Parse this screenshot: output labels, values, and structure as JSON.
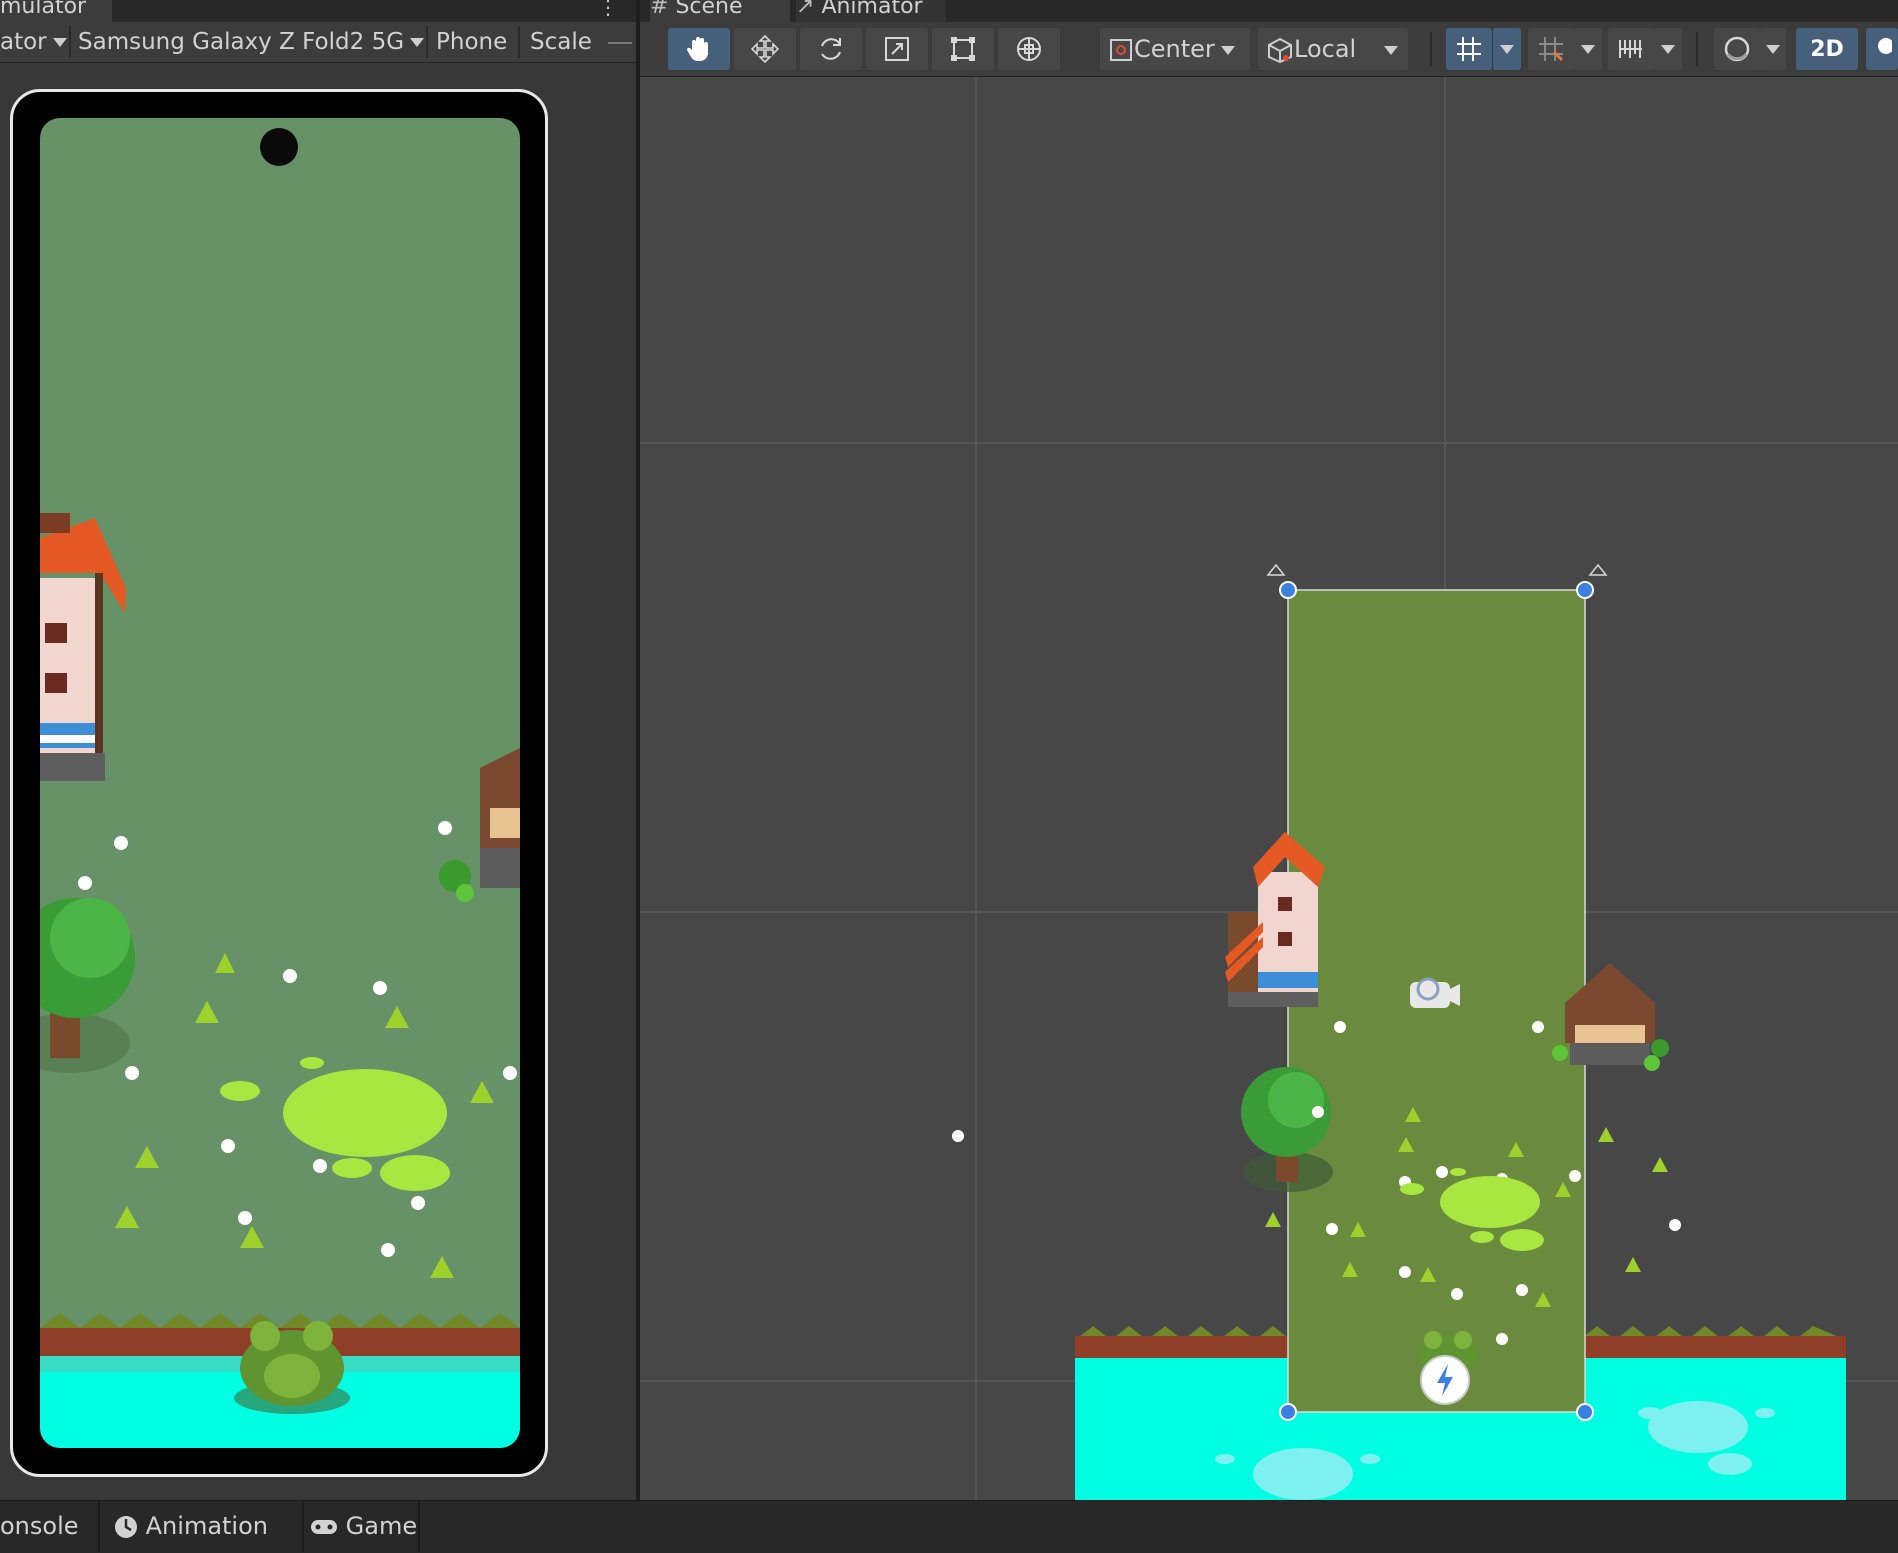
{
  "simulator": {
    "tab_title": "mulator",
    "menu_dots": "⋮",
    "toolbar": {
      "simulator_dropdown": "ator",
      "device_dropdown": "Samsung Galaxy Z Fold2 5G",
      "phone_label": "Phone",
      "scale_label": "Scale"
    }
  },
  "scene": {
    "tabs": [
      {
        "label": "Scene",
        "icon": "hash-icon"
      },
      {
        "label": "Animator",
        "icon": "animator-icon"
      }
    ],
    "toolbar": {
      "tools": [
        "hand-tool",
        "move-tool",
        "rotate-tool",
        "scale-tool",
        "rect-tool",
        "transform-tool"
      ],
      "pivot_mode": "Center",
      "pivot_rotation": "Local",
      "mode_2d": "2D"
    },
    "colors": {
      "background": "#474747",
      "camera_frame": "#6a8b3e",
      "water": "#00ffe2",
      "grass_strip": "#6f8a27",
      "dirt_strip": "#8f3e27",
      "accent_active": "#46607c"
    }
  },
  "bottom_tabs": [
    {
      "label": "onsole",
      "icon": "console-icon"
    },
    {
      "label": "Animation",
      "icon": "clock-icon"
    },
    {
      "label": "Game",
      "icon": "gamepad-icon"
    }
  ]
}
